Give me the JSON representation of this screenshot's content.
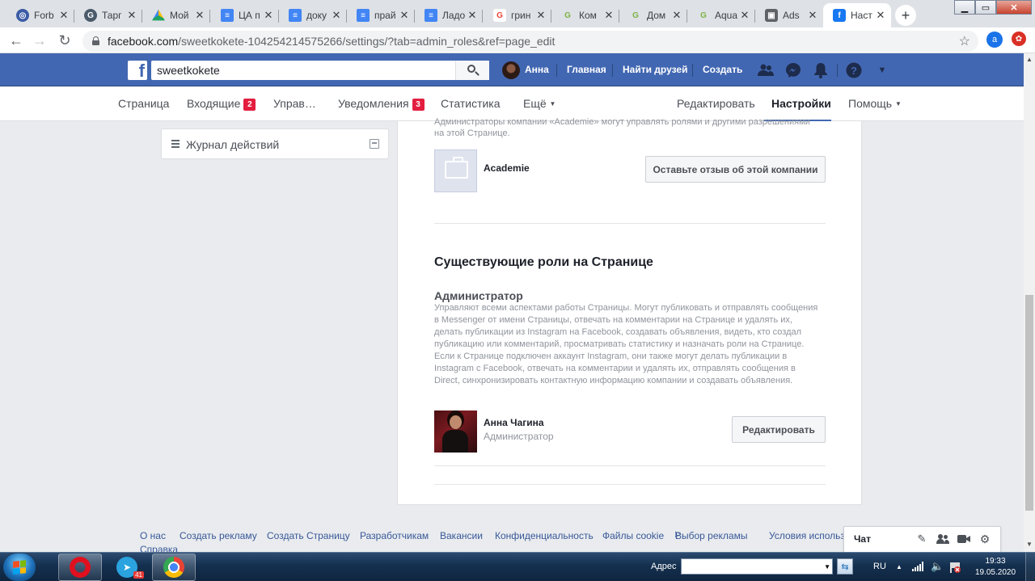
{
  "browser": {
    "tabs": [
      {
        "title": "Forb",
        "icon": "forbes-icon",
        "color": "#3b5ba5"
      },
      {
        "title": "Тарг",
        "icon": "gs-icon",
        "color": "#4a5a6a"
      },
      {
        "title": "Мой",
        "icon": "google-drive-icon",
        "color": "#1fa463"
      },
      {
        "title": "ЦА п",
        "icon": "google-docs-icon",
        "color": "#4285f4"
      },
      {
        "title": "доку",
        "icon": "google-docs-icon",
        "color": "#4285f4"
      },
      {
        "title": "прай",
        "icon": "google-docs-icon",
        "color": "#4285f4"
      },
      {
        "title": "Ладо",
        "icon": "google-docs-icon",
        "color": "#4285f4"
      },
      {
        "title": "грин",
        "icon": "google-icon",
        "color": "#ea4335"
      },
      {
        "title": "Ком",
        "icon": "gl-icon",
        "color": "#7cb342"
      },
      {
        "title": "Дом",
        "icon": "gl-icon",
        "color": "#7cb342"
      },
      {
        "title": "Aqua",
        "icon": "gl-icon",
        "color": "#7cb342"
      },
      {
        "title": "Ads",
        "icon": "ads-icon",
        "color": "#5f6368"
      },
      {
        "title": "Наст",
        "icon": "facebook-icon",
        "color": "#1877f2"
      }
    ],
    "url_host": "facebook.com",
    "url_rest": "/sweetkokete-104254214575266/settings/?tab=admin_roles&ref=page_edit",
    "profile_letter": "a"
  },
  "fb": {
    "search_value": "sweetkokete",
    "user_name": "Анна",
    "nav": {
      "home": "Главная",
      "find_friends": "Найти друзей",
      "create": "Создать"
    }
  },
  "page_tabs": {
    "page": "Страница",
    "inbox": "Входящие",
    "inbox_badge": "2",
    "manage": "Управ…",
    "notifications": "Уведомления",
    "notifications_badge": "3",
    "stats": "Статистика",
    "more": "Ещё",
    "edit": "Редактировать",
    "settings": "Настройки",
    "help": "Помощь"
  },
  "left": {
    "activity_log": "Журнал действий"
  },
  "main": {
    "cutoff_text": "Администраторы компании «Academie» могут управлять ролями и другими разрешениями на этой Странице.",
    "business_name": "Academie",
    "review_button": "Оставьте отзыв об этой компании",
    "section_title": "Существующие роли на Странице",
    "role_title": "Администратор",
    "role_description": "Управляют всеми аспектами работы Страницы. Могут публиковать и отправлять сообщения в Messenger от имени Страницы, отвечать на комментарии на Странице и удалять их, делать публикации из Instagram на Facebook, создавать объявления, видеть, кто создал публикацию или комментарий, просматривать статистику и назначать роли на Странице. Если к Странице подключен аккаунт Instagram, они также могут делать публикации в Instagram с Facebook, отвечать на комментарии и удалять их, отправлять сообщения в Direct, синхронизировать контактную информацию компании и создавать объявления.",
    "person_name": "Анна Чагина",
    "person_role": "Администратор",
    "edit_button": "Редактировать"
  },
  "footer": {
    "links": [
      "О нас",
      "Создать рекламу",
      "Создать Страницу",
      "Разработчикам",
      "Вакансии",
      "Конфиденциальность",
      "Файлы cookie",
      "Выбор рекламы",
      "Условия использо",
      "Справка"
    ]
  },
  "chat": {
    "label": "Чат"
  },
  "taskbar": {
    "address_label": "Адрес",
    "lang": "RU",
    "time": "19:33",
    "date": "19.05.2020",
    "telegram_badge": "41"
  },
  "colors": {
    "fb_blue": "#4267b2",
    "badge_red": "#e41e3f",
    "link": "#385898"
  }
}
